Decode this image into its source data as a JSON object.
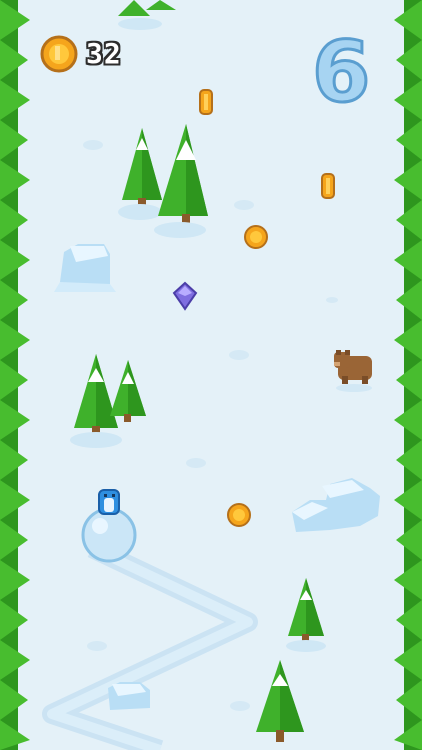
{
  "hud": {
    "coin_count": "32",
    "score": "6"
  },
  "colors": {
    "snow": "#e4f1f8",
    "tree_green": "#3fb12b",
    "tree_dark": "#268a1a",
    "trail": "#cfe6f4",
    "coin": "#f5a51c",
    "gem": "#7f6ee0",
    "snowball": "#cbe6f7",
    "player": "#2f8fe0",
    "bear": "#9a6536"
  },
  "icons": {
    "hud_coin": "coin-icon",
    "gem": "gem-icon",
    "bear": "bear-icon",
    "player": "penguin-icon"
  }
}
